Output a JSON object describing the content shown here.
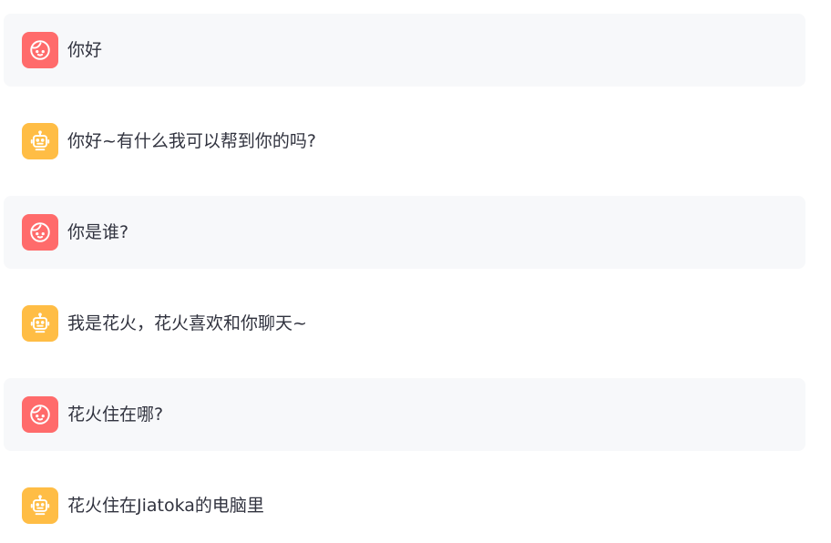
{
  "chat": {
    "messages": [
      {
        "role": "user",
        "avatar_icon": "user-face-icon",
        "text": "你好"
      },
      {
        "role": "assistant",
        "avatar_icon": "robot-icon",
        "text": "你好~有什么我可以帮到你的吗?"
      },
      {
        "role": "user",
        "avatar_icon": "user-face-icon",
        "text": "你是谁?"
      },
      {
        "role": "assistant",
        "avatar_icon": "robot-icon",
        "text": "我是花火，花火喜欢和你聊天~"
      },
      {
        "role": "user",
        "avatar_icon": "user-face-icon",
        "text": "花火住在哪?"
      },
      {
        "role": "assistant",
        "avatar_icon": "robot-icon",
        "text": "花火住在Jiatoka的电脑里"
      }
    ]
  },
  "colors": {
    "user_avatar_bg": "#ff6b6b",
    "assistant_avatar_bg": "#ffbd45",
    "user_row_bg": "#f7f8fa",
    "text": "#31333f"
  }
}
